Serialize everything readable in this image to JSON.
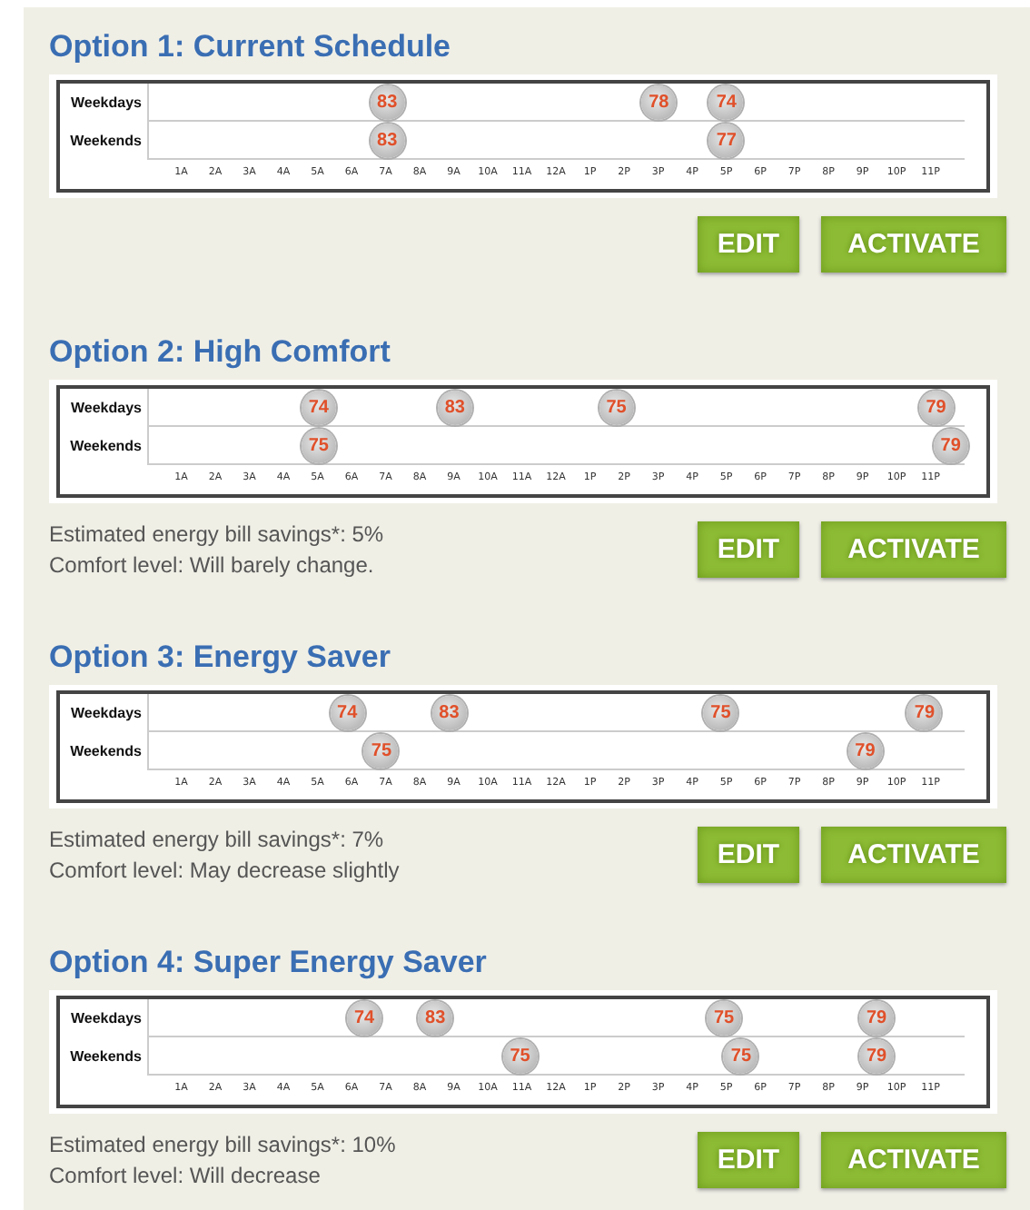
{
  "options": [
    {
      "title": "Option 1: Current Schedule",
      "schedule": {
        "hours": [
          "1A",
          "2A",
          "3A",
          "4A",
          "5A",
          "6A",
          "7A",
          "8A",
          "9A",
          "10A",
          "11A",
          "12A",
          "1P",
          "2P",
          "3P",
          "4P",
          "5P",
          "6P",
          "7P",
          "8P",
          "9P",
          "10P",
          "11P"
        ],
        "rows": [
          {
            "label": "Weekdays",
            "setpoints": [
              {
                "level": 0.292,
                "temp": "83"
              },
              {
                "level": 0.625,
                "temp": "78"
              },
              {
                "level": 0.708,
                "temp": "74"
              }
            ]
          },
          {
            "label": "Weekends",
            "setpoints": [
              {
                "level": 0.292,
                "temp": "83"
              },
              {
                "level": 0.708,
                "temp": "77"
              }
            ]
          }
        ]
      },
      "buttons": [
        "EDIT",
        "ACTIVATE"
      ]
    },
    {
      "title": "Option 2: High Comfort",
      "schedule": {
        "hours": [
          "1A",
          "2A",
          "3A",
          "4A",
          "5A",
          "6A",
          "7A",
          "8A",
          "9A",
          "10A",
          "11A",
          "12A",
          "1P",
          "2P",
          "3P",
          "4P",
          "5P",
          "6P",
          "7P",
          "8P",
          "9P",
          "10P",
          "11P"
        ],
        "rows": [
          {
            "label": "Weekdays",
            "setpoints": [
              {
                "level": 0.208,
                "temp": "74"
              },
              {
                "level": 0.375,
                "temp": "83"
              },
              {
                "level": 0.573,
                "temp": "75"
              },
              {
                "level": 0.965,
                "temp": "79"
              }
            ]
          },
          {
            "label": "Weekends",
            "setpoints": [
              {
                "level": 0.208,
                "temp": "75"
              },
              {
                "level": 0.983,
                "temp": "79"
              }
            ]
          }
        ]
      },
      "savings": "Estimated energy bill savings*: 5%",
      "comfort": "Comfort level: Will barely change.",
      "buttons": [
        "EDIT",
        "ACTIVATE"
      ]
    },
    {
      "title": "Option 3: Energy Saver",
      "schedule": {
        "hours": [
          "1A",
          "2A",
          "3A",
          "4A",
          "5A",
          "6A",
          "7A",
          "8A",
          "9A",
          "10A",
          "11A",
          "12A",
          "1P",
          "2P",
          "3P",
          "4P",
          "5P",
          "6P",
          "7P",
          "8P",
          "9P",
          "10P",
          "11P"
        ],
        "rows": [
          {
            "label": "Weekdays",
            "setpoints": [
              {
                "level": 0.243,
                "temp": "74"
              },
              {
                "level": 0.368,
                "temp": "83"
              },
              {
                "level": 0.701,
                "temp": "75"
              },
              {
                "level": 0.951,
                "temp": "79"
              }
            ]
          },
          {
            "label": "Weekends",
            "setpoints": [
              {
                "level": 0.285,
                "temp": "75"
              },
              {
                "level": 0.878,
                "temp": "79"
              }
            ]
          }
        ]
      },
      "savings": "Estimated energy bill savings*: 7%",
      "comfort": "Comfort level: May decrease slightly",
      "buttons": [
        "EDIT",
        "ACTIVATE"
      ]
    },
    {
      "title": "Option 4: Super Energy Saver",
      "schedule": {
        "hours": [
          "1A",
          "2A",
          "3A",
          "4A",
          "5A",
          "6A",
          "7A",
          "8A",
          "9A",
          "10A",
          "11A",
          "12A",
          "1P",
          "2P",
          "3P",
          "4P",
          "5P",
          "6P",
          "7P",
          "8P",
          "9P",
          "10P",
          "11P"
        ],
        "rows": [
          {
            "label": "Weekdays",
            "setpoints": [
              {
                "level": 0.264,
                "temp": "74"
              },
              {
                "level": 0.351,
                "temp": "83"
              },
              {
                "level": 0.705,
                "temp": "75"
              },
              {
                "level": 0.892,
                "temp": "79"
              }
            ]
          },
          {
            "label": "Weekends",
            "setpoints": [
              {
                "level": 0.455,
                "temp": "75"
              },
              {
                "level": 0.726,
                "temp": "75"
              },
              {
                "level": 0.892,
                "temp": "79"
              }
            ]
          }
        ]
      },
      "savings": "Estimated energy bill savings*: 10%",
      "comfort": "Comfort level: Will decrease",
      "buttons": [
        "EDIT",
        "ACTIVATE"
      ]
    }
  ]
}
